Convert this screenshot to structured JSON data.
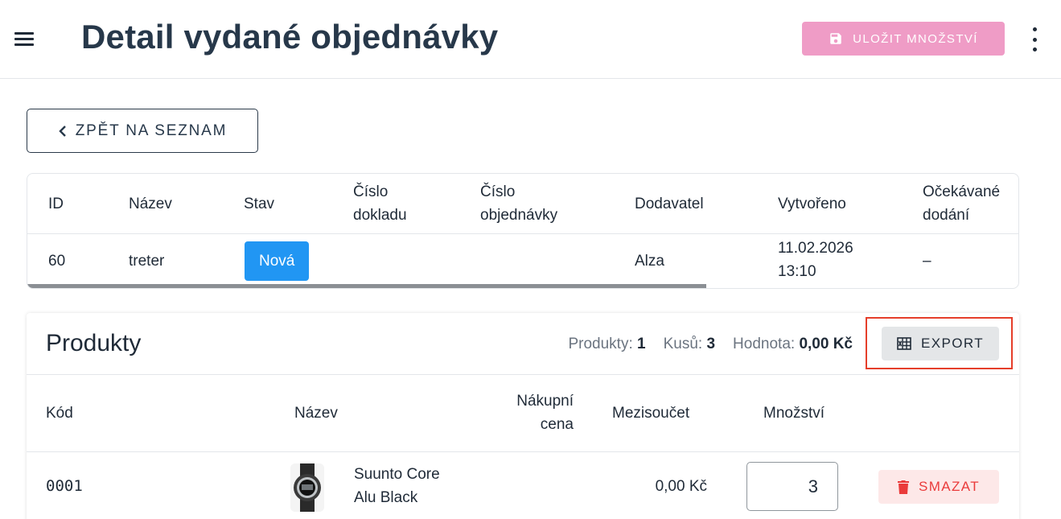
{
  "header": {
    "title": "Detail vydané objednávky",
    "save_label": "ULOŽIT MNOŽSTVÍ"
  },
  "back_label": "ZPĚT NA SEZNAM",
  "order_table": {
    "columns": [
      "ID",
      "Název",
      "Stav",
      "Číslo\ndokladu",
      "Číslo\nobjednávky",
      "Dodavatel",
      "Vytvořeno",
      "Očekávané\ndodání"
    ],
    "row": {
      "id": "60",
      "name": "treter",
      "status": "Nová",
      "doc_number": "",
      "order_number": "",
      "supplier": "Alza",
      "created": "11.02.2026\n13:10",
      "expected": "–"
    },
    "status_color": "#2196f3"
  },
  "products": {
    "title": "Produkty",
    "stats": {
      "products_label": "Produkty:",
      "products_value": "1",
      "pieces_label": "Kusů:",
      "pieces_value": "3",
      "value_label": "Hodnota:",
      "value_value": "0,00 Kč"
    },
    "export_label": "EXPORT",
    "columns": {
      "code": "Kód",
      "name": "Název",
      "purchase_price": "Nákupní\ncena",
      "subtotal": "Mezisoučet",
      "quantity": "Množství"
    },
    "items": [
      {
        "code": "0001",
        "name": "Suunto Core\nAlu Black",
        "purchase_price": "",
        "subtotal": "0,00 Kč",
        "quantity": "3",
        "delete_label": "SMAZAT"
      }
    ]
  },
  "colors": {
    "title": "#27384a",
    "save_button": "#ef9cc6",
    "status_badge": "#2196f3",
    "export_highlight": "#e53e2a",
    "delete_text": "#ea3b3b",
    "delete_bg": "#fde8e8"
  }
}
